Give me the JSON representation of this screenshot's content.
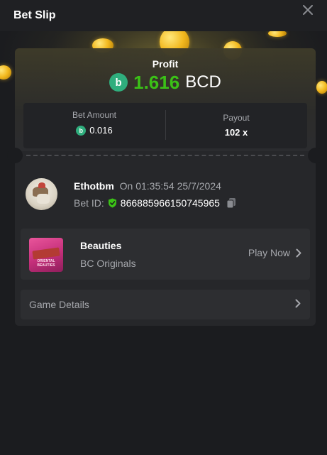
{
  "header": {
    "title": "Bet Slip",
    "close_icon": "close-icon"
  },
  "profit": {
    "label": "Profit",
    "value": "1.616",
    "currency": "BCD",
    "value_color": "#3bc117",
    "currency_icon": "bcd-coin-icon"
  },
  "stats": {
    "bet_amount_label": "Bet Amount",
    "bet_amount_value": "0.016",
    "payout_label": "Payout",
    "payout_value": "102 x"
  },
  "user": {
    "name": "Ethotbm",
    "on_label": "On 01:35:54 25/7/2024",
    "bet_id_label": "Bet ID:",
    "bet_id": "866885966150745965",
    "verified_icon": "shield-check-icon",
    "copy_icon": "copy-icon"
  },
  "game": {
    "name": "Beauties",
    "provider": "BC Originals",
    "play_label": "Play Now",
    "thumb_text": "ORIENTAL BEAUTIES"
  },
  "details": {
    "label": "Game Details"
  },
  "colors": {
    "accent_green": "#3bc117",
    "coin_green": "#2fae7d",
    "panel": "#27282b",
    "background": "#1b1c1f"
  }
}
